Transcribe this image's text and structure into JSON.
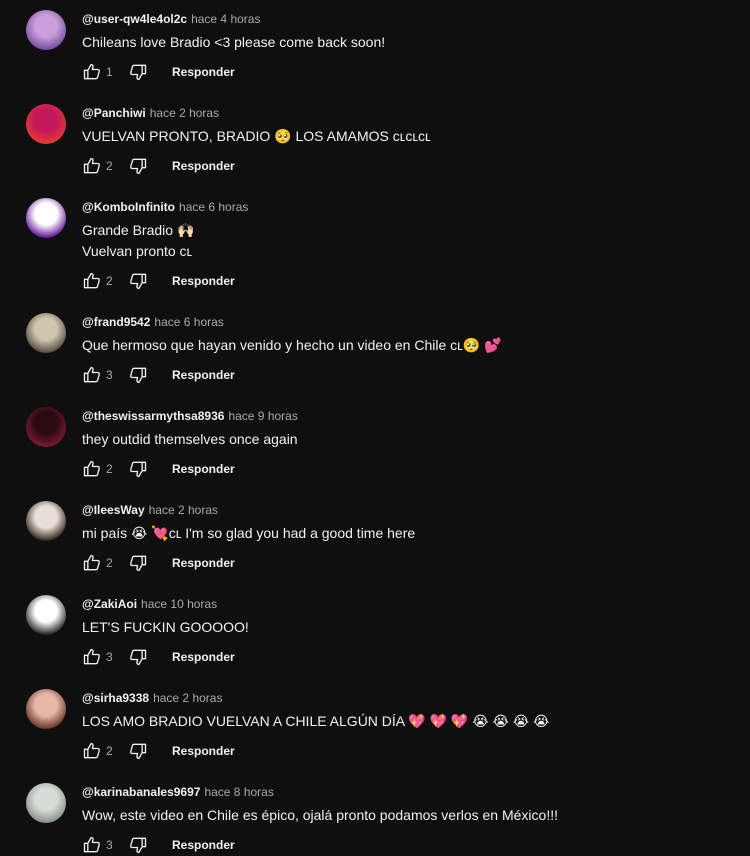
{
  "reply_label": "Responder",
  "comments": [
    {
      "author": "@user-qw4le4ol2c",
      "time": "hace 4 horas",
      "text": "Chileans love Bradio <3 please come back soon!",
      "likes": "1",
      "avatar_colors": [
        "#c9a0dc",
        "#7a4fa0"
      ]
    },
    {
      "author": "@Panchiwi",
      "time": "hace 2 horas",
      "text": "VUELVAN PRONTO, BRADIO 🥺  LOS AMAMOS ᴄʟᴄʟᴄʟ",
      "likes": "2",
      "avatar_colors": [
        "#c2185b",
        "#e53935"
      ]
    },
    {
      "author": "@KomboInfinito",
      "time": "hace 6 horas",
      "text": "Grande Bradio 🙌🏻\nVuelvan pronto ᴄʟ",
      "likes": "2",
      "avatar_colors": [
        "#ffffff",
        "#6a1b9a"
      ]
    },
    {
      "author": "@frand9542",
      "time": "hace 6 horas",
      "text": "Que hermoso que hayan venido y hecho un video en Chile ᴄʟ🥺 💕",
      "likes": "3",
      "avatar_colors": [
        "#cfc6b0",
        "#5a5040"
      ]
    },
    {
      "author": "@theswissarmythsa8936",
      "time": "hace 9 horas",
      "text": "they outdid themselves once again",
      "likes": "2",
      "avatar_colors": [
        "#2a0a10",
        "#7a1a30"
      ]
    },
    {
      "author": "@IleesWay",
      "time": "hace 2 horas",
      "text": "mi país 😭 💘ᴄʟ I'm so glad you had a good time here",
      "likes": "2",
      "avatar_colors": [
        "#e8e0d8",
        "#3a2a20"
      ]
    },
    {
      "author": "@ZakiAoi",
      "time": "hace 10 horas",
      "text": "LET'S FUCKIN GOOOOO!",
      "likes": "3",
      "avatar_colors": [
        "#ffffff",
        "#2a2a2a"
      ]
    },
    {
      "author": "@sirha9338",
      "time": "hace 2 horas",
      "text": "LOS AMO BRADIO VUELVAN A CHILE ALGÚN DÍA 💖 💖 💖 😭 😭 😭 😭",
      "likes": "2",
      "avatar_colors": [
        "#e6b8a8",
        "#6a3a2a"
      ]
    },
    {
      "author": "@karinabanales9697",
      "time": "hace 8 horas",
      "text": "Wow, este video en Chile es épico, ojalá pronto podamos verlos en México!!!",
      "likes": "3",
      "avatar_colors": [
        "#d6dcd6",
        "#8a948a"
      ]
    }
  ]
}
